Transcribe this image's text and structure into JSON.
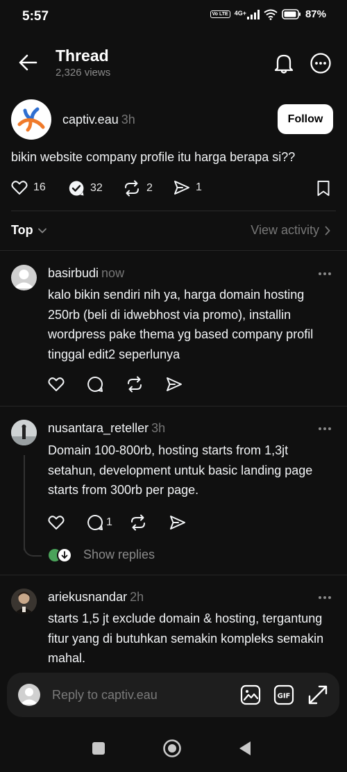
{
  "status": {
    "time": "5:57",
    "battery": "87%",
    "network": "4G+",
    "volte": "Vo LTE"
  },
  "header": {
    "title": "Thread",
    "views": "2,326 views",
    "back_icon": "back-arrow-icon",
    "bell_icon": "bell-icon",
    "more_icon": "more-icon"
  },
  "post": {
    "username": "captiv.eau",
    "time": "3h",
    "follow_label": "Follow",
    "text": "bikin website company profile itu harga berapa si??",
    "likes": "16",
    "replies": "32",
    "reposts": "2",
    "shares": "1"
  },
  "sort": {
    "label": "Top",
    "activity_label": "View activity"
  },
  "replies": [
    {
      "username": "basirbudi",
      "time": "now",
      "text": "kalo bikin sendiri nih ya, harga domain hosting 250rb (beli di idwebhost via promo), installin wordpress pake thema yg based company profil tinggal edit2 seperlunya",
      "reply_count": ""
    },
    {
      "username": "nusantara_reteller",
      "time": "3h",
      "text": "Domain 100-800rb, hosting starts from 1,3jt setahun, development untuk basic landing page starts from 300rb per page.",
      "reply_count": "1",
      "show_replies": "Show replies"
    },
    {
      "username": "ariekusnandar",
      "time": "2h",
      "text": "starts 1,5  jt exclude domain & hosting, tergantung fitur yang di butuhkan semakin kompleks semakin mahal."
    }
  ],
  "composer": {
    "placeholder": "Reply to captiv.eau"
  },
  "colors": {
    "background": "#101010",
    "text": "#f3f5f7",
    "muted": "#777777",
    "button_bg": "#ffffff"
  }
}
